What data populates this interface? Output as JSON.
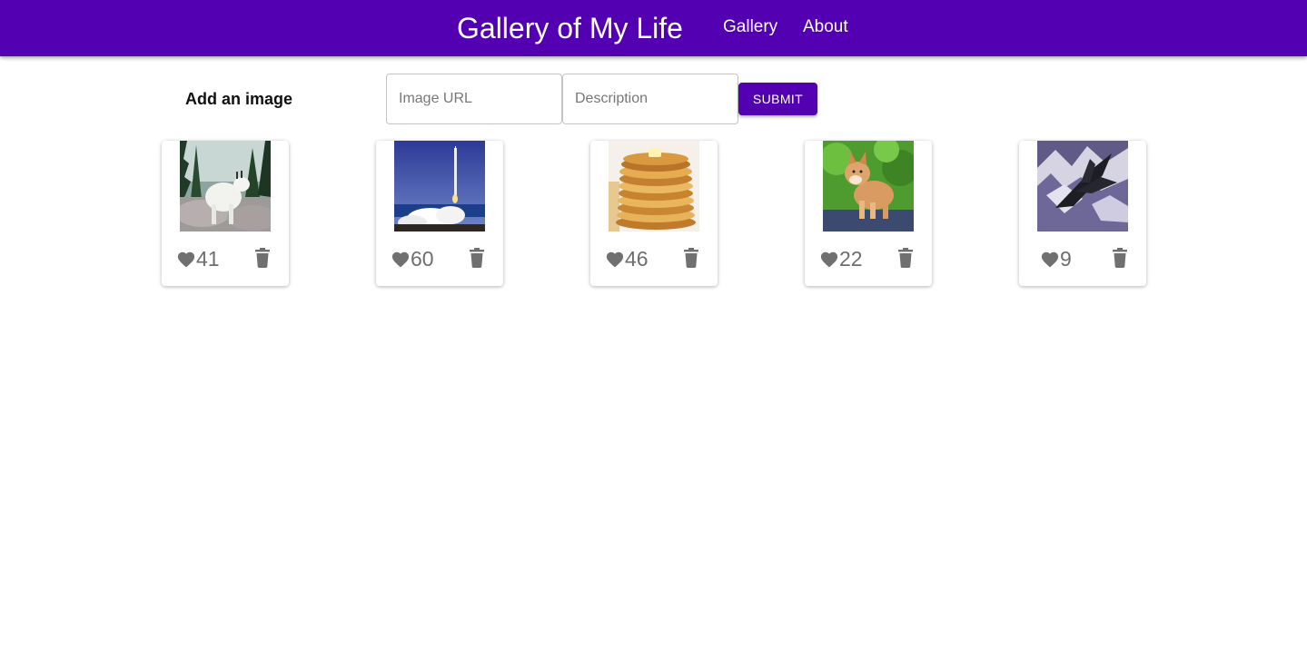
{
  "header": {
    "title": "Gallery of My Life",
    "nav": [
      {
        "label": "Gallery"
      },
      {
        "label": "About"
      }
    ],
    "color": "#5300b3"
  },
  "form": {
    "label": "Add an image",
    "url_placeholder": "Image URL",
    "description_placeholder": "Description",
    "submit_label": "SUBMIT"
  },
  "gallery": [
    {
      "subject": "mountain goat",
      "likes": "41"
    },
    {
      "subject": "rocket launch",
      "likes": "60"
    },
    {
      "subject": "pancakes",
      "likes": "46"
    },
    {
      "subject": "shiba inu puppy",
      "likes": "22"
    },
    {
      "subject": "sr-71 jet",
      "likes": "9"
    }
  ]
}
